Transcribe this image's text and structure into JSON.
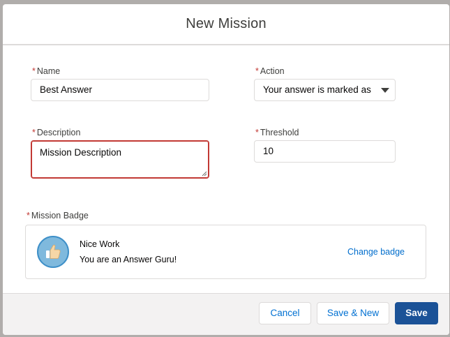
{
  "modal": {
    "title": "New Mission"
  },
  "form": {
    "required_marker": "*",
    "name": {
      "label": "Name",
      "value": "Best Answer"
    },
    "action": {
      "label": "Action",
      "value": "Your answer is marked as b"
    },
    "description": {
      "label": "Description",
      "value": "Mission Description"
    },
    "threshold": {
      "label": "Threshold",
      "value": "10"
    },
    "badge": {
      "label": "Mission Badge",
      "name": "Nice Work",
      "description": "You are an Answer Guru!",
      "change_link": "Change badge",
      "icon": "thumbs-up-icon"
    }
  },
  "footer": {
    "cancel_label": "Cancel",
    "save_new_label": "Save & New",
    "save_label": "Save"
  },
  "colors": {
    "brand": "#1b5297",
    "error": "#c23934",
    "link": "#006dcc"
  }
}
